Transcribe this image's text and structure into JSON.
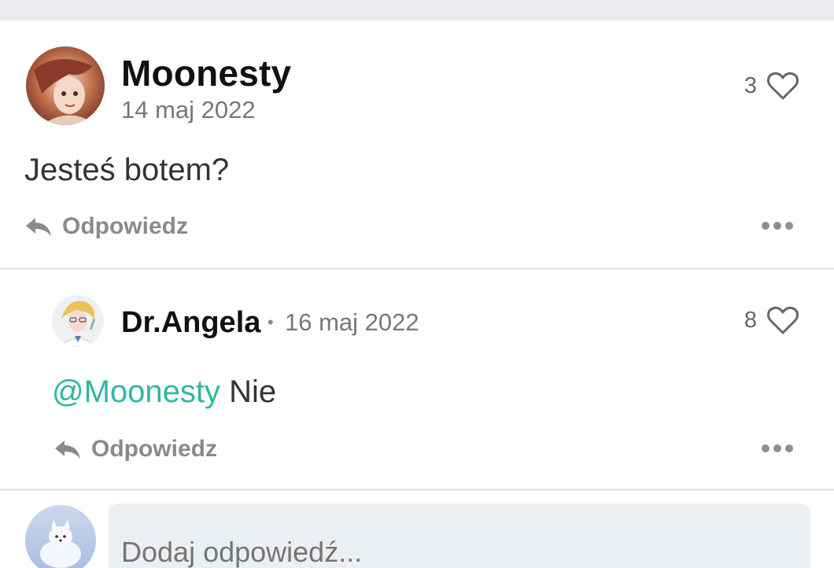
{
  "main_comment": {
    "username": "Moonesty",
    "date": "14 maj 2022",
    "likes": "3",
    "text": "Jesteś botem?",
    "reply_label": "Odpowiedz"
  },
  "reply_comment": {
    "username": "Dr.Angela",
    "separator": "•",
    "date": "16 maj 2022",
    "likes": "8",
    "mention": "@Moonesty",
    "text": " Nie",
    "reply_label": "Odpowiedz"
  },
  "composer": {
    "placeholder": "Dodaj odpowiedź..."
  },
  "colors": {
    "mention": "#2fb7a2",
    "background": "#ffffff",
    "divider": "#e6e8eb",
    "input_bg": "#eceff1"
  },
  "icons": [
    "heart-icon",
    "reply-arrow-icon",
    "more-options-icon"
  ]
}
